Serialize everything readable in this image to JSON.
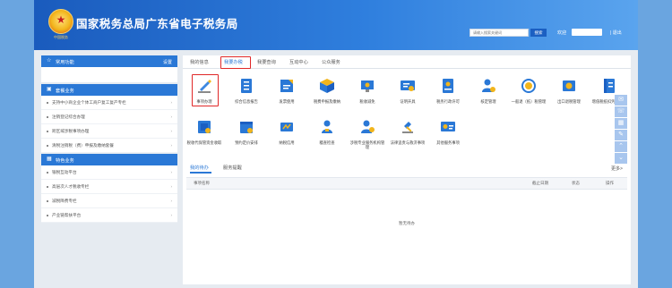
{
  "header": {
    "site_title": "国家税务总局广东省电子税务局",
    "emblem_caption": "中国税务",
    "search_placeholder": "请输入搜索关键词",
    "search_button": "搜索",
    "welcome": "欢迎",
    "logout": "| 退出"
  },
  "sidebar": {
    "common_functions": {
      "title": "常用功能",
      "settings": "设置"
    },
    "package_services": {
      "title": "套餐业务",
      "items": [
        "支持中小商企业个体工商户复工复产专栏",
        "注销登记综合办理",
        "跨区域涉税事项办理",
        "清税注销税（费）申报及缴纳套餐"
      ]
    },
    "special_services": {
      "title": "特色业务",
      "items": [
        "银税互动平台",
        "高层次人才税收专栏",
        "减税降费专栏",
        "产业链帮扶平台"
      ]
    }
  },
  "tabs": [
    "我的信息",
    "我要办税",
    "我要查询",
    "互动中心",
    "公众服务"
  ],
  "active_tab_index": 1,
  "service_icons": [
    "事项办理",
    "综合信息报告",
    "发票使用",
    "税费申报及缴纳",
    "税收减免",
    "证明开具",
    "税务行政许可",
    "核定管理",
    "一般退（抵）税管理",
    "出口退税管理",
    "增值税抵扣凭证管理",
    "税收代保管资金收取",
    "预约定价安排",
    "纳税信用",
    "稽查检查",
    "涉税专业服务机构管理",
    "法律追责与救济事项",
    "其他服务事项"
  ],
  "bottom_tabs": [
    "我的待办",
    "服务提醒"
  ],
  "more_link": "更多>",
  "table_headers": [
    "事项名称",
    "截止日期",
    "状态",
    "操作"
  ],
  "empty_text": "暂无待办",
  "colors": {
    "primary": "#2a78d6",
    "highlight_box": "#e02828",
    "header_dark": "#1a5bbd"
  }
}
